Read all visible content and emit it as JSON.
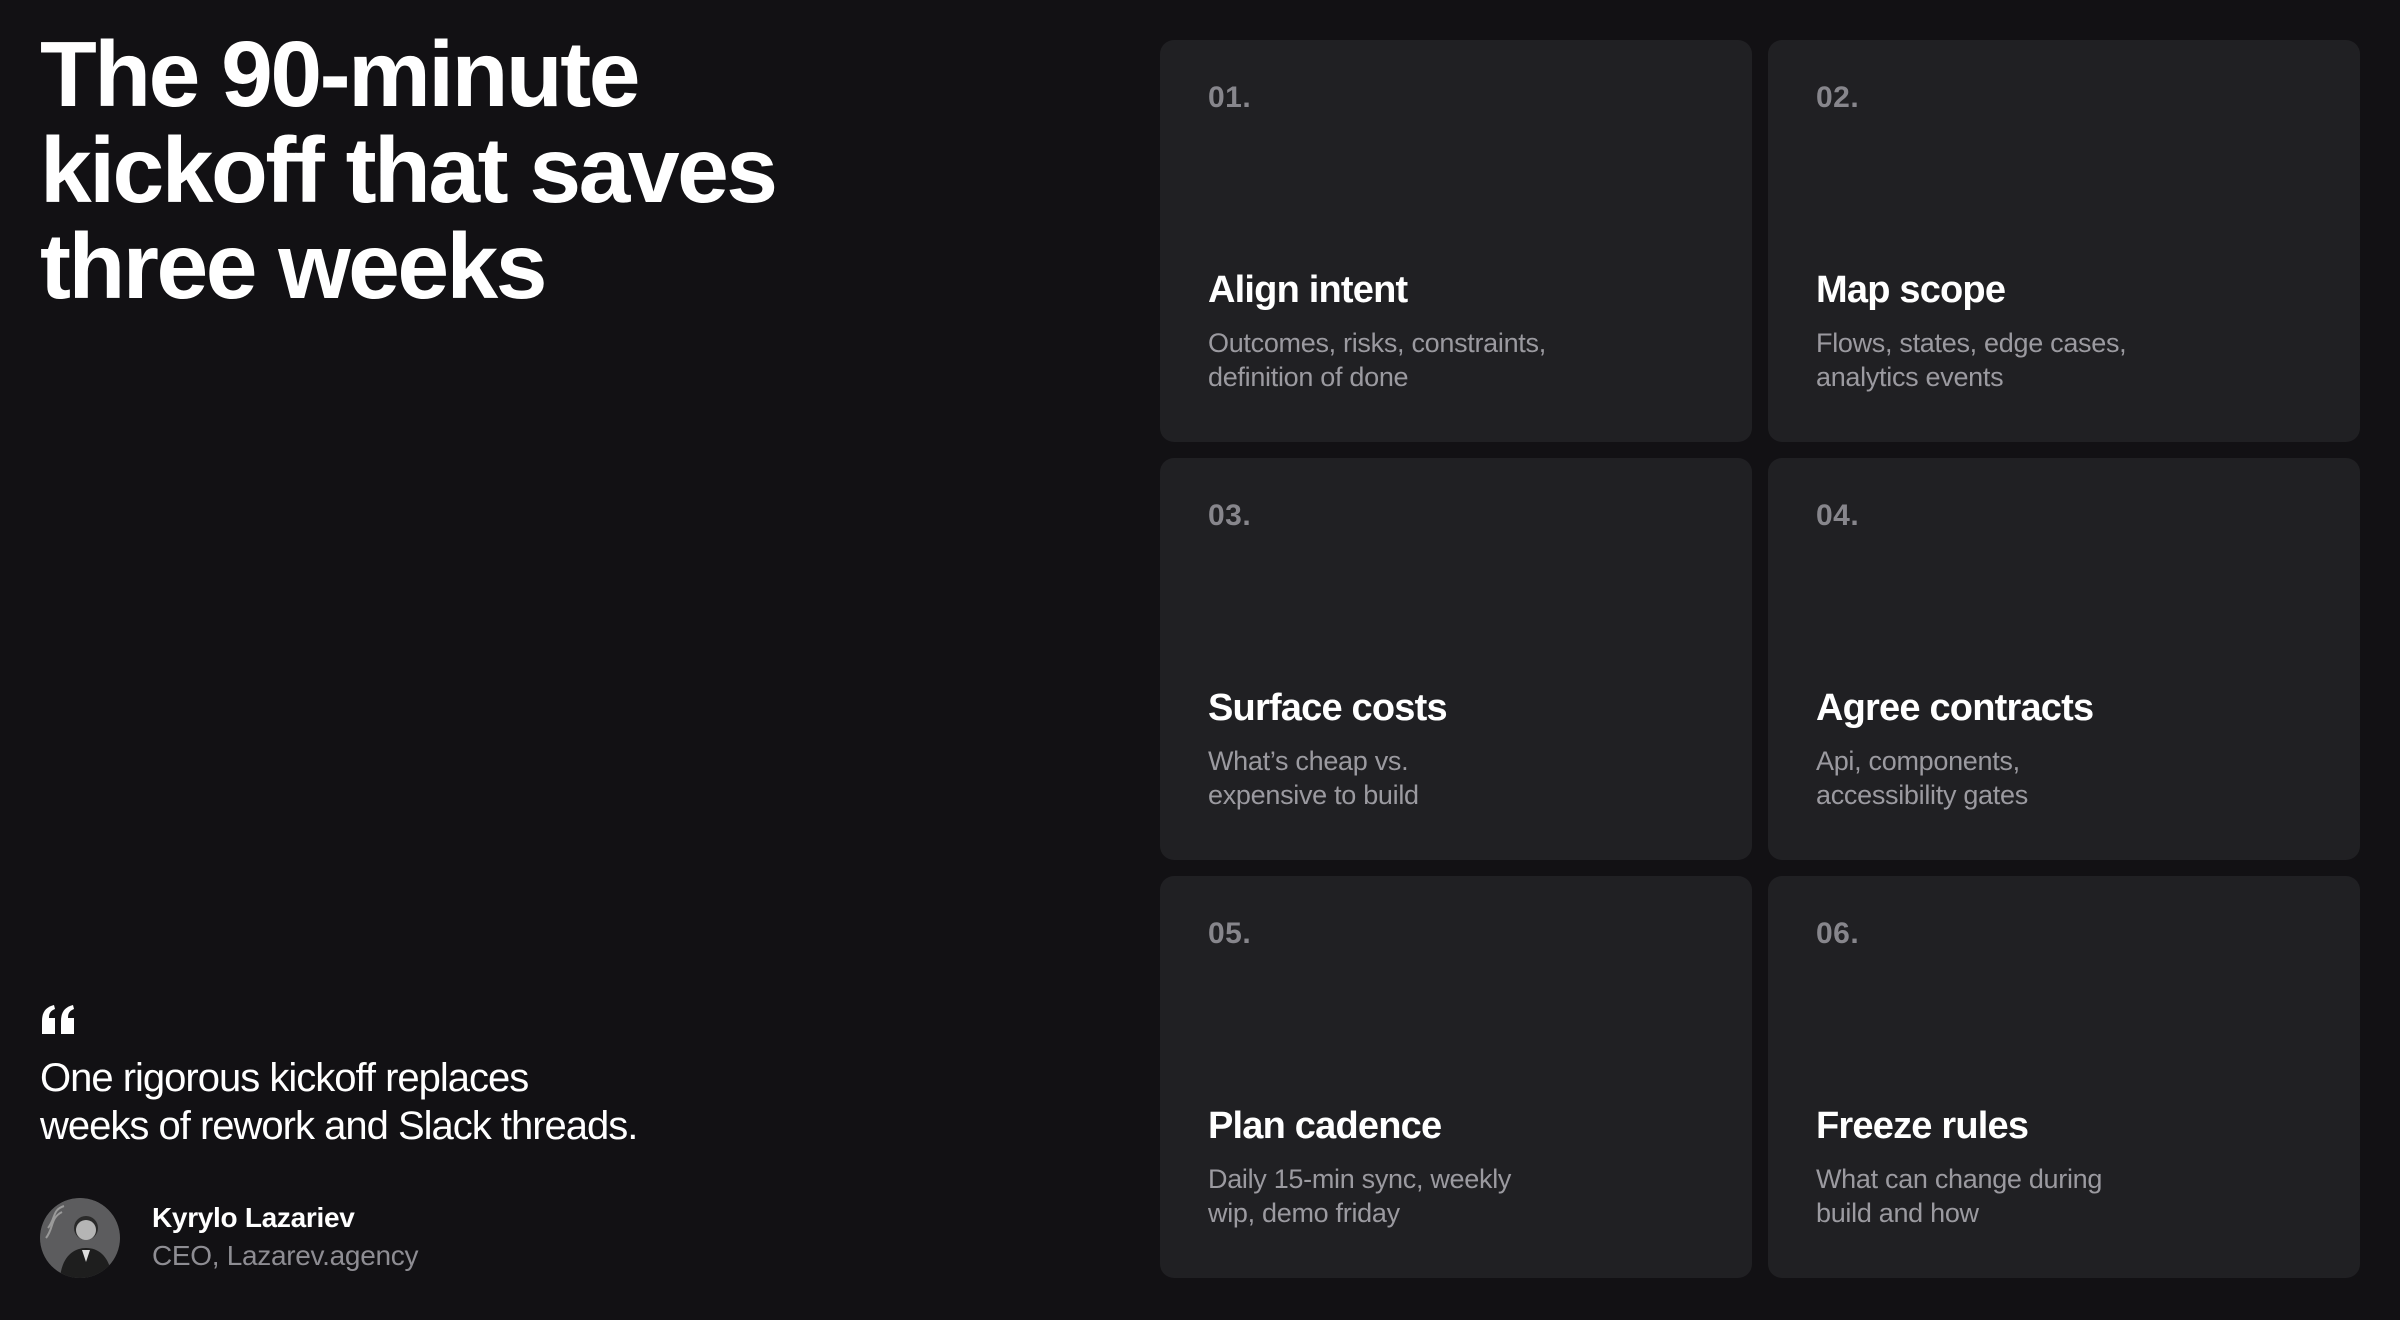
{
  "headline": {
    "line1": "The 90-minute",
    "line2": "kickoff that saves",
    "line3": "three weeks"
  },
  "quote": {
    "icon": "quote-mark-icon",
    "line1": "One rigorous kickoff replaces",
    "line2": "weeks of rework and Slack threads."
  },
  "author": {
    "name": "Kyrylo Lazariev",
    "role": "CEO, Lazarev.agency"
  },
  "cards": [
    {
      "num": "01.",
      "title": "Align intent",
      "desc1": "Outcomes, risks, constraints,",
      "desc2": "definition of done"
    },
    {
      "num": "02.",
      "title": "Map scope",
      "desc1": "Flows, states, edge cases,",
      "desc2": "analytics events"
    },
    {
      "num": "03.",
      "title": "Surface costs",
      "desc1": "What’s cheap vs.",
      "desc2": "expensive to build"
    },
    {
      "num": "04.",
      "title": "Agree contracts",
      "desc1": "Api, components,",
      "desc2": "accessibility gates"
    },
    {
      "num": "05.",
      "title": "Plan cadence",
      "desc1": "Daily 15-min sync, weekly",
      "desc2": "wip, demo friday"
    },
    {
      "num": "06.",
      "title": "Freeze rules",
      "desc1": "What can change during",
      "desc2": "build and how"
    }
  ],
  "colors": {
    "background": "#121114",
    "card": "#202023",
    "muted_text": "#9b9aa0",
    "number_text": "#87868c"
  }
}
